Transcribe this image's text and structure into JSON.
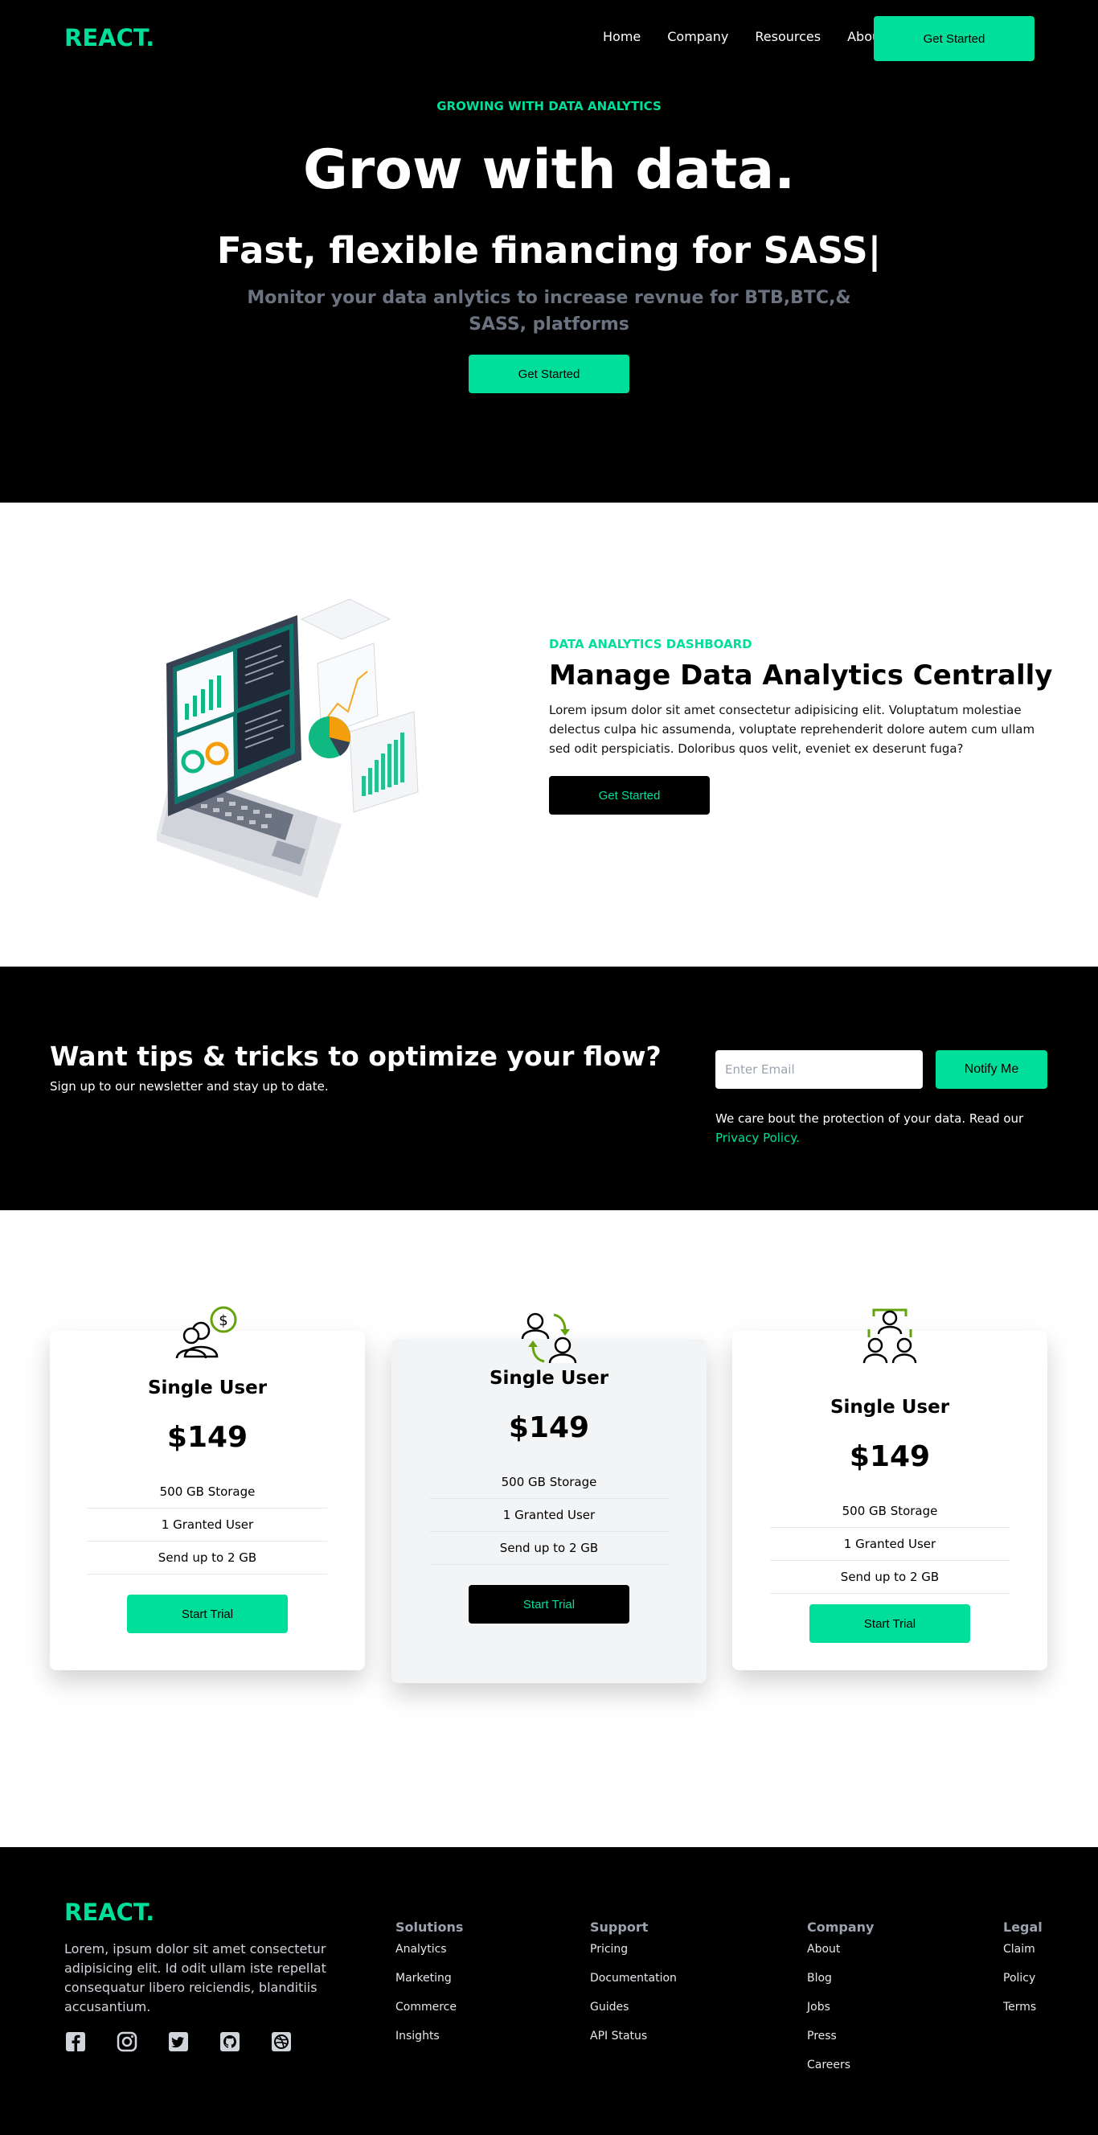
{
  "brand": "REACT.",
  "nav": {
    "links": [
      "Home",
      "Company",
      "Resources",
      "About"
    ],
    "cta": "Get Started"
  },
  "hero": {
    "eyebrow": "GROWING WITH DATA ANALYTICS",
    "title": "Grow with data.",
    "subtitle": "Fast, flexible financing for SASS|",
    "description": "Monitor your data anlytics to increase revnue for BTB,BTC,& SASS, platforms",
    "cta": "Get Started"
  },
  "analytics": {
    "eyebrow": "DATA ANALYTICS DASHBOARD",
    "title": "Manage Data Analytics Centrally",
    "text": "Lorem ipsum dolor sit amet consectetur adipisicing elit. Voluptatum molestiae delectus culpa hic assumenda, voluptate reprehenderit dolore autem cum ullam sed odit perspiciatis. Doloribus quos velit, eveniet ex deserunt fuga?",
    "cta": "Get Started"
  },
  "newsletter": {
    "title": "Want tips & tricks to optimize your flow?",
    "subtitle": "Sign up to our newsletter and stay up to date.",
    "placeholder": "Enter Email",
    "button": "Notify Me",
    "note": "We care bout the protection of your data. Read our",
    "link": "Privacy Policy."
  },
  "pricing": {
    "plans": [
      {
        "icon": "single-user-dollar-icon",
        "title": "Single User",
        "price": "$149",
        "features": [
          "500 GB Storage",
          "1 Granted User",
          "Send up to 2 GB"
        ],
        "cta": "Start Trial"
      },
      {
        "icon": "user-swap-icon",
        "title": "Single User",
        "price": "$149",
        "features": [
          "500 GB Storage",
          "1 Granted User",
          "Send up to 2 GB"
        ],
        "cta": "Start Trial"
      },
      {
        "icon": "user-group-icon",
        "title": "Single User",
        "price": "$149",
        "features": [
          "500 GB Storage",
          "1 Granted User",
          "Send up to 2 GB"
        ],
        "cta": "Start Trial"
      }
    ]
  },
  "footer": {
    "brand": "REACT.",
    "text": "Lorem, ipsum dolor sit amet consectetur adipisicing elit. Id odit ullam iste repellat consequatur libero reiciendis, blanditiis accusantium.",
    "socials": [
      "facebook-icon",
      "instagram-icon",
      "twitter-icon",
      "github-icon",
      "dribbble-icon"
    ],
    "columns": [
      {
        "title": "Solutions",
        "items": [
          "Analytics",
          "Marketing",
          "Commerce",
          "Insights"
        ]
      },
      {
        "title": "Support",
        "items": [
          "Pricing",
          "Documentation",
          "Guides",
          "API Status"
        ]
      },
      {
        "title": "Company",
        "items": [
          "About",
          "Blog",
          "Jobs",
          "Press",
          "Careers"
        ]
      },
      {
        "title": "Legal",
        "items": [
          "Claim",
          "Policy",
          "Terms"
        ]
      }
    ]
  },
  "colors": {
    "accent": "#00df9a",
    "dark": "#000000",
    "muted": "#6b7280"
  }
}
